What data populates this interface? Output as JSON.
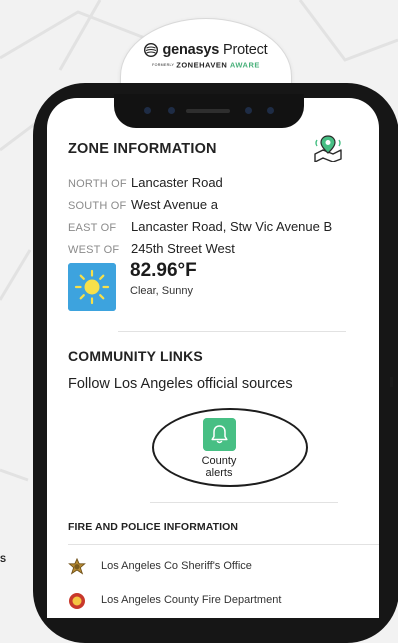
{
  "brand": {
    "name_bold": "genasys",
    "name_light": "Protect",
    "formerly": "FORMERLY",
    "sub_main": "ZONEHAVEN",
    "sub_accent": "AWARE"
  },
  "zone": {
    "title": "ZONE INFORMATION",
    "rows": [
      {
        "key": "NORTH OF",
        "value": "Lancaster Road"
      },
      {
        "key": "SOUTH OF",
        "value": "West Avenue a"
      },
      {
        "key": "EAST OF",
        "value": "Lancaster Road, Stw Vic Avenue B"
      },
      {
        "key": "WEST OF",
        "value": "245th Street West"
      }
    ]
  },
  "weather": {
    "temperature": "82.96°F",
    "condition": "Clear, Sunny"
  },
  "community": {
    "title": "COMMUNITY LINKS",
    "subtitle": "Follow Los Angeles official sources",
    "county_alerts_label": "County alerts"
  },
  "fire_police": {
    "title": "FIRE AND POLICE INFORMATION",
    "items": [
      {
        "label": "Los Angeles Co Sheriff's Office"
      },
      {
        "label": "Los Angeles County Fire Department"
      }
    ]
  },
  "side_text": "S",
  "colors": {
    "accent_green": "#47bf84",
    "weather_blue": "#3da3de",
    "phone_frame": "#161616"
  }
}
